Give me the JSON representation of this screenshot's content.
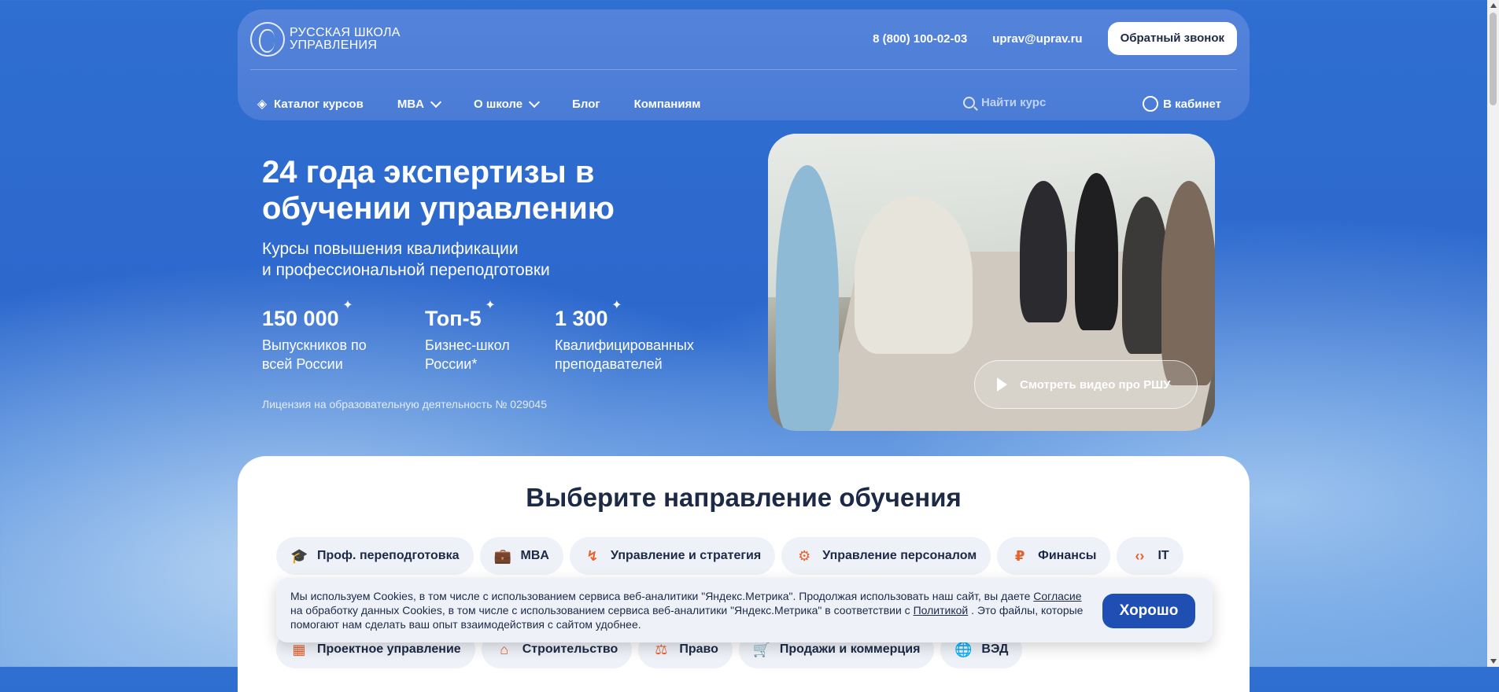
{
  "header": {
    "logo_line1": "РУССКАЯ ШКОЛА",
    "logo_line2": "УПРАВЛЕНИЯ",
    "phone": "8 (800) 100-02-03",
    "email": "uprav@uprav.ru",
    "callback": "Обратный звонок"
  },
  "nav": {
    "catalog": "Каталог курсов",
    "mba": "MBA",
    "about": "О школе",
    "blog": "Блог",
    "companies": "Компаниям",
    "search_placeholder": "Найти курс",
    "cabinet": "В кабинет"
  },
  "hero": {
    "title": "24 года экспертизы в обучении управлению",
    "subtitle_line1": "Курсы повышения квалификации",
    "subtitle_line2": "и профессиональной переподготовки",
    "stats": [
      {
        "value": "150 000",
        "line1": "Выпускников по",
        "line2": "всей России"
      },
      {
        "value": "Топ-5",
        "line1": "Бизнес-школ",
        "line2": "России*"
      },
      {
        "value": "1 300",
        "line1": "Квалифицированных",
        "line2": "преподавателей"
      }
    ],
    "license": "Лицензия на образовательную деятельность № 029045",
    "video_button": "Смотреть видео про РШУ"
  },
  "directions": {
    "title": "Выберите направление обучения",
    "row1": [
      {
        "label": "Проф. переподготовка",
        "icon": "graduation-cap-icon",
        "glyph": "🎓"
      },
      {
        "label": "MBA",
        "icon": "briefcase-icon",
        "glyph": "💼"
      },
      {
        "label": "Управление и стратегия",
        "icon": "route-icon",
        "glyph": "↯"
      },
      {
        "label": "Управление персоналом",
        "icon": "people-gear-icon",
        "glyph": "⚙"
      },
      {
        "label": "Финансы",
        "icon": "money-bag-icon",
        "glyph": "₽"
      },
      {
        "label": "IT",
        "icon": "code-icon",
        "glyph": "‹›"
      }
    ],
    "row2": [
      {
        "label": "Проектное управление",
        "icon": "project-grid-icon",
        "glyph": "▦"
      },
      {
        "label": "Строительство",
        "icon": "paint-roller-icon",
        "glyph": "⌂"
      },
      {
        "label": "Право",
        "icon": "scales-icon",
        "glyph": "⚖"
      },
      {
        "label": "Продажи и коммерция",
        "icon": "cart-icon",
        "glyph": "🛒"
      },
      {
        "label": "ВЭД",
        "icon": "globe-icon",
        "glyph": "🌐"
      }
    ]
  },
  "cookie": {
    "text1": "Мы используем Cookies, в том числе с использованием сервиса веб-аналитики \"Яндекс.Метрика\". Продолжая использовать наш сайт, вы даете",
    "link1": "Согласие",
    "text2": " на обработку данных Cookies, в том числе с использованием сервиса веб-аналитики \"Яндекс.Метрика\" в соответствии с ",
    "link2": "Политикой",
    "text3": " . Это файлы, которые помогают нам сделать ваш опыт взаимодействия с сайтом удобнее.",
    "ok": "Хорошо"
  },
  "colors": {
    "accent": "#1f4fb2",
    "icon_orange": "#e8602c",
    "heading": "#1c2947"
  }
}
